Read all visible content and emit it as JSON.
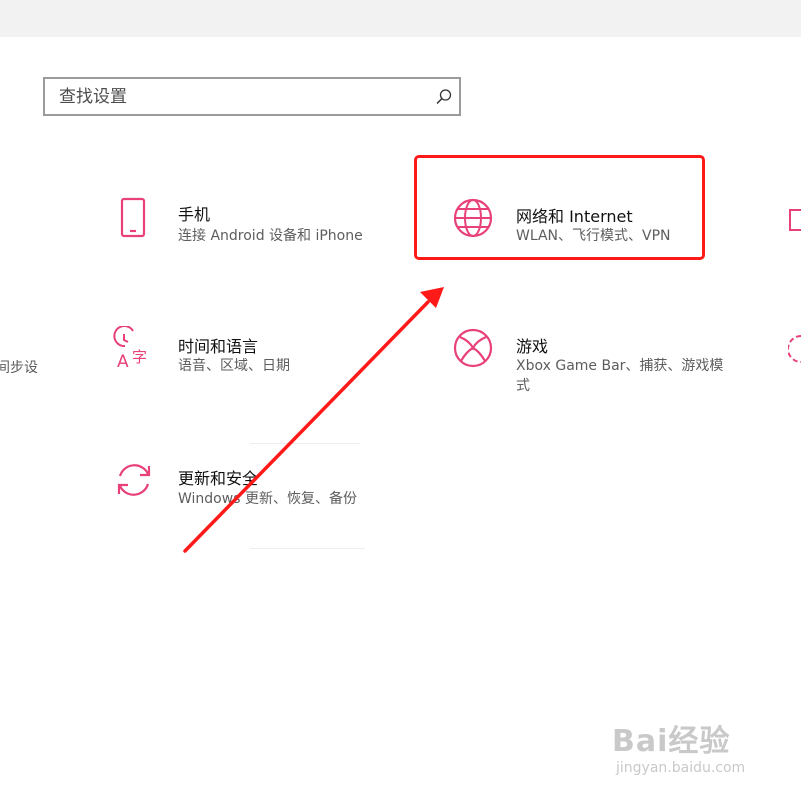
{
  "search": {
    "placeholder": "查找设置",
    "icon": "search-icon"
  },
  "tiles": [
    {
      "title": "手机",
      "desc": "连接 Android 设备和 iPhone",
      "icon": "phone-icon"
    },
    {
      "title": "网络和 Internet",
      "desc": "WLAN、飞行模式、VPN",
      "icon": "globe-icon"
    },
    {
      "title": "时间和语言",
      "desc": "语音、区域、日期",
      "icon": "time-language-icon"
    },
    {
      "title": "游戏",
      "desc": "Xbox Game Bar、捕获、游戏模式",
      "icon": "xbox-icon"
    },
    {
      "title": "更新和安全",
      "desc": "Windows 更新、恢复、备份",
      "icon": "update-icon"
    }
  ],
  "partials": {
    "left_desc": "间步设"
  },
  "watermark": {
    "main": "Bai经验",
    "url": "jingyan.baidu.com"
  },
  "colors": {
    "accent": "#e8407a",
    "highlight": "#ff1a1a"
  }
}
